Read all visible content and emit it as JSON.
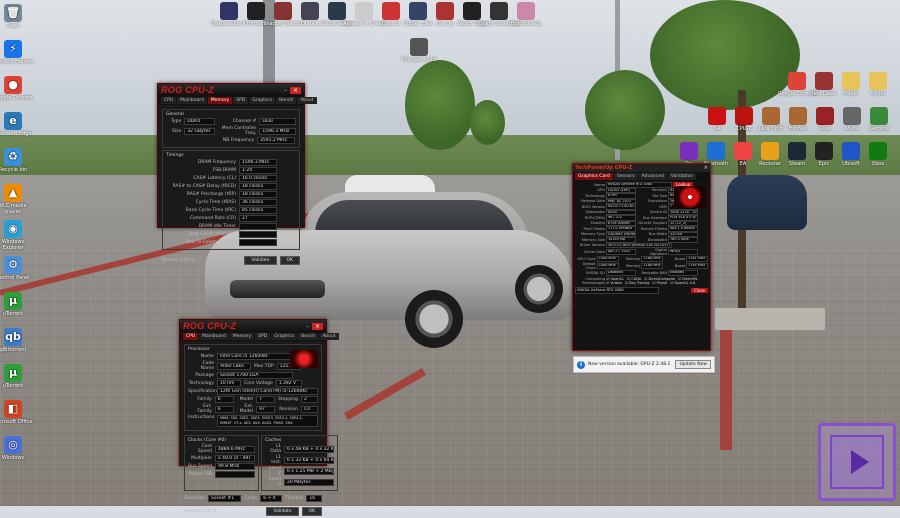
{
  "left_icons": [
    {
      "label": "Trash",
      "color": "#778899",
      "glyph": "🗑"
    },
    {
      "label": "Sherlock Holmes",
      "color": "#1a73e8",
      "glyph": "⚡"
    },
    {
      "label": "Google Chrome",
      "color": "#db4437",
      "glyph": "●"
    },
    {
      "label": "Microsoft Edge",
      "color": "#2a7ab8",
      "glyph": "e"
    },
    {
      "label": "Recycle bin",
      "color": "#3b8fd6",
      "glyph": "♻"
    },
    {
      "label": "VLC media player",
      "color": "#f08c00",
      "glyph": "▲"
    },
    {
      "label": "Windows Explorer",
      "color": "#2a9fd6",
      "glyph": "◉"
    },
    {
      "label": "Control Panel",
      "color": "#4a90d9",
      "glyph": "⚙"
    },
    {
      "label": "uTorrent",
      "color": "#2e9e3c",
      "glyph": "µ"
    },
    {
      "label": "qBittorrent",
      "color": "#3e7bc8",
      "glyph": "qb"
    },
    {
      "label": "uTorrent",
      "color": "#2e9e3c",
      "glyph": "µ"
    },
    {
      "label": "Microsoft Office",
      "color": "#d04423",
      "glyph": "◧"
    },
    {
      "label": "Windows",
      "color": "#4a6fd6",
      "glyph": "◎"
    }
  ],
  "top_icons": [
    {
      "label": "Desperados III",
      "color": "#336"
    },
    {
      "label": "Hitman",
      "color": "#222"
    },
    {
      "label": "Shadow Warrior",
      "color": "#833"
    },
    {
      "label": "Outlast",
      "color": "#445"
    },
    {
      "label": "Ghost Recon",
      "color": "#2a3a4a"
    },
    {
      "label": "Assassin's Creed",
      "color": "#ccc"
    },
    {
      "label": "Control",
      "color": "#c33"
    },
    {
      "label": "Sniper Elite",
      "color": "#346"
    },
    {
      "label": "Far Cry",
      "color": "#a33"
    },
    {
      "label": "Watch Dogs",
      "color": "#222"
    },
    {
      "label": "Death Stranding",
      "color": "#333"
    },
    {
      "label": "Borderlands",
      "color": "#c8a"
    },
    {
      "label": "The Last of Us",
      "color": "#555"
    }
  ],
  "right_icons_row1": [
    {
      "label": "Google Chrome",
      "color": "#db4437"
    },
    {
      "label": "Red Dead",
      "color": "#933"
    },
    {
      "label": "Folder",
      "color": "#e8c35a"
    },
    {
      "label": "Folder",
      "color": "#e8c35a"
    }
  ],
  "right_icons_row2": [
    {
      "label": "64",
      "color": "#c11"
    },
    {
      "label": "CPU-Z",
      "color": "#b11"
    },
    {
      "label": "Lara Croft",
      "color": "#a63"
    },
    {
      "label": "Hitman",
      "color": "#a63"
    },
    {
      "label": "Rise",
      "color": "#922"
    },
    {
      "label": "Mafia",
      "color": "#666"
    },
    {
      "label": "Geforce",
      "color": "#3a8a3a"
    }
  ],
  "right_icons_row3": [
    {
      "label": "Tor",
      "color": "#7b2fbe"
    },
    {
      "label": "Bluetooth",
      "color": "#1e6fd4"
    },
    {
      "label": "EA",
      "color": "#e44"
    },
    {
      "label": "Rockstar",
      "color": "#e9a11a"
    },
    {
      "label": "Steam",
      "color": "#1b2838"
    },
    {
      "label": "Epic",
      "color": "#222"
    },
    {
      "label": "Ubisoft",
      "color": "#2055c8"
    },
    {
      "label": "Xbox",
      "color": "#107c10"
    }
  ],
  "cpuz_top": {
    "title": "ROG CPU-Z",
    "tabs": [
      "CPU",
      "Mainboard",
      "Memory",
      "SPD",
      "Graphics",
      "Bench",
      "About"
    ],
    "active_tab": "Memory",
    "general_title": "General",
    "type_label": "Type",
    "type_value": "DDR4",
    "channel_label": "Channel #",
    "channel_value": "Dual",
    "size_label": "Size",
    "size_value": "32 GBytes",
    "memctrl_label": "Mem Controller Freq.",
    "memctrl_value": "1596.3 MHz",
    "nbfreq_label": "NB Frequency",
    "nbfreq_value": "3591.2 MHz",
    "timings_title": "Timings",
    "timings": [
      {
        "label": "DRAM Frequency",
        "value": "1596.3 MHz"
      },
      {
        "label": "FSB:DRAM",
        "value": "1:24"
      },
      {
        "label": "CAS# Latency (CL)",
        "value": "16.0 clocks"
      },
      {
        "label": "RAS# to CAS# Delay (tRCD)",
        "value": "18 clocks"
      },
      {
        "label": "RAS# Precharge (tRP)",
        "value": "18 clocks"
      },
      {
        "label": "Cycle Time (tRAS)",
        "value": "36 clocks"
      },
      {
        "label": "Bank Cycle Time (tRC)",
        "value": "85 clocks"
      },
      {
        "label": "Command Rate (CR)",
        "value": "2T"
      },
      {
        "label": "DRAM Idle Timer",
        "value": ""
      },
      {
        "label": "Total CAS# (tRDRAM)",
        "value": ""
      },
      {
        "label": "Row To Column (tRCD)",
        "value": ""
      }
    ],
    "version": "Version 1.97.0",
    "validate": "Validate",
    "ok": "OK"
  },
  "cpuz_bottom": {
    "title": "ROG CPU-Z",
    "tabs": [
      "CPU",
      "Mainboard",
      "Memory",
      "SPD",
      "Graphics",
      "Bench",
      "About"
    ],
    "active_tab": "CPU",
    "processor_title": "Processor",
    "name_label": "Name",
    "name_value": "Intel Core i5 12600KF",
    "codename_label": "Code Name",
    "codename_value": "Alder Lake",
    "maxtdp_label": "Max TDP",
    "maxtdp_value": "125.0 W",
    "package_label": "Package",
    "package_value": "Socket 1700 LGA",
    "technology_label": "Technology",
    "technology_value": "10 nm",
    "corevoltage_label": "Core Voltage",
    "corevoltage_value": "1.392 V",
    "spec_label": "Specification",
    "spec_value": "12th Gen Intel(R) Core(TM) i5-12600KF",
    "family_label": "Family",
    "family_value": "6",
    "model_label": "Model",
    "model_value": "7",
    "stepping_label": "Stepping",
    "stepping_value": "2",
    "extfamily_label": "Ext. Family",
    "extfamily_value": "6",
    "extmodel_label": "Ext. Model",
    "extmodel_value": "97",
    "revision_label": "Revision",
    "revision_value": "C0",
    "instructions_label": "Instructions",
    "instructions_value": "MMX, SSE, SSE2, SSE3, SSSE3, SSE4.1, SSE4.2, EM64T, VT-x, AES, AVX, AVX2, FMA3, SHA",
    "clocks_title": "Clocks (Core #0)",
    "corespeed_label": "Core Speed",
    "corespeed_value": "4889.6 MHz",
    "multiplier_label": "Multiplier",
    "multiplier_value": "x 49.0 (4 - 49)",
    "busspeed_label": "Bus Speed",
    "busspeed_value": "99.8 MHz",
    "ratedfsb_label": "Rated FSB",
    "ratedfsb_value": "",
    "cache_title": "Caches",
    "l1d_label": "L1 Data",
    "l1d_value": "6 x 48 KB + 4 x 32 KB",
    "l1i_label": "L1 Inst.",
    "l1i_value": "6 x 32 KB + 4 x 64 KB",
    "l2_label": "Level 2",
    "l2_value": "6 x 1.25 MB + 2 MBytes",
    "l3_label": "Level 3",
    "l3_value": "20 MBytes",
    "selection_label": "Selection",
    "selection_value": "Socket #1",
    "cores_label": "Cores",
    "cores_value": "6 + 4",
    "threads_label": "Threads",
    "threads_value": "16",
    "version": "Version 1.97.0",
    "validate": "Validate",
    "ok": "OK"
  },
  "gpuz": {
    "title": "TechPowerUp GPU-Z",
    "tabs": [
      "Graphics Card",
      "Sensors",
      "Advanced",
      "Validation"
    ],
    "lookup": "Lookup",
    "rows": [
      {
        "label": "Name",
        "value": "NVIDIA GeForce RTX 3080"
      },
      {
        "label": "GPU",
        "value": "GA102 (LHR)"
      },
      {
        "label": "Revision",
        "value": "A1"
      },
      {
        "label": "Technology",
        "value": "8 nm"
      },
      {
        "label": "Die Size",
        "value": "628 mm²"
      },
      {
        "label": "Release Date",
        "value": "May 18, 2021"
      },
      {
        "label": "Transistors",
        "value": "28000M"
      },
      {
        "label": "BIOS Version",
        "value": "94.02.71.40.B1"
      },
      {
        "label": "UEFI",
        "value": "✓"
      },
      {
        "label": "Subvendor",
        "value": "ASUS"
      },
      {
        "label": "Device ID",
        "value": "10DE 2216 - 1043 8822"
      },
      {
        "label": "ROPs/TMUs",
        "value": "96 / 272"
      },
      {
        "label": "Bus Interface",
        "value": "PCIe x16 4.0 @ x16 1.1"
      },
      {
        "label": "Shaders",
        "value": "8704 Unified"
      },
      {
        "label": "DirectX Support",
        "value": "12 (12_2)"
      },
      {
        "label": "Pixel Fillrate",
        "value": "171.0 GPixel/s"
      },
      {
        "label": "Texture Fillrate",
        "value": "484.1 GTexel/s"
      },
      {
        "label": "Memory Type",
        "value": "GDDR6X (Micron)"
      },
      {
        "label": "Bus Width",
        "value": "320 bit"
      },
      {
        "label": "Memory Size",
        "value": "10240 MB"
      },
      {
        "label": "Bandwidth",
        "value": "760.3 GB/s"
      },
      {
        "label": "Driver Version",
        "value": "30.0.15.1620 (NVIDIA 516.20) DCH / Win11 64"
      },
      {
        "label": "Driver Date",
        "value": "Apr 27, 2022"
      },
      {
        "label": "Digital Signature",
        "value": "WHQL"
      },
      {
        "label": "GPU Clock",
        "value": "1440 MHz"
      },
      {
        "label": "Memory",
        "value": "1188 MHz"
      },
      {
        "label": "Boost",
        "value": "1781 MHz"
      },
      {
        "label": "Default Clock",
        "value": "1440 MHz"
      },
      {
        "label": "Memory",
        "value": "1188 MHz"
      },
      {
        "label": "Boost",
        "value": "1785 MHz"
      },
      {
        "label": "NVIDIA SLI",
        "value": "Disabled"
      },
      {
        "label": "Resizable BAR",
        "value": "Enabled"
      }
    ],
    "computing_label": "Computing",
    "computing": [
      "OpenCL",
      "CUDA",
      "DirectCompute",
      "DirectML"
    ],
    "technologies_label": "Technologies",
    "technologies": [
      "Vulkan",
      "Ray Tracing",
      "PhysX",
      "OpenGL 4.6"
    ],
    "select_value": "NVIDIA GeForce RTX 3080",
    "close": "Close"
  },
  "update": {
    "text": "New version available: GPU-Z 2.48.1",
    "button": "Update Now"
  }
}
